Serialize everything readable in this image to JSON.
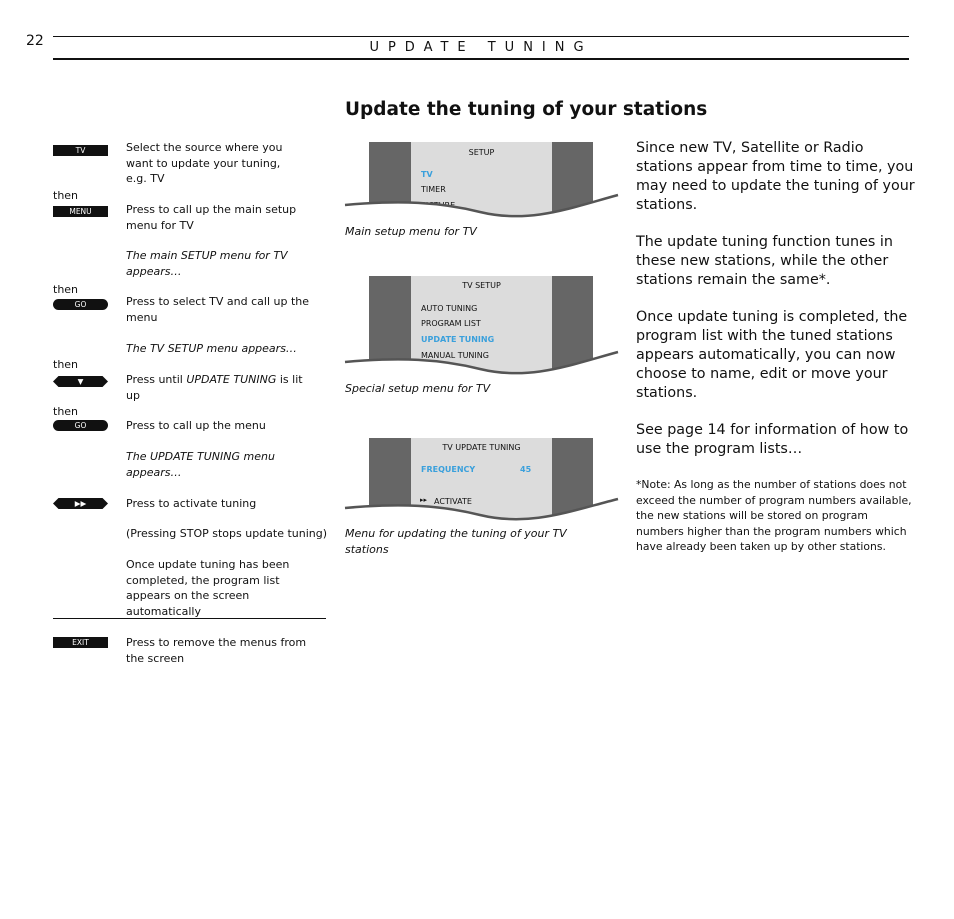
{
  "header": {
    "page_number": "22",
    "section_title": "UPDATE TUNING"
  },
  "heading": "Update the tuning of your stations",
  "steps": {
    "then": "then",
    "key_tv": "TV",
    "text_tv": "Select the source where you want to update your tuning, e.g. TV",
    "key_menu": "MENU",
    "text_menu": "Press to call up the main setup menu for TV",
    "note_setup": "The main SETUP menu for TV appears…",
    "key_go": "GO",
    "text_go1": "Press to select TV and call up the menu",
    "note_tvsetup": "The TV SETUP menu appears…",
    "key_down": "▼",
    "text_down_a": "Press until ",
    "text_down_b": "UPDATE TUNING",
    "text_down_c": " is lit up",
    "text_go2": "Press to call up the menu",
    "note_update": "The UPDATE TUNING menu appears…",
    "key_ff": "▶▶",
    "text_ff": "Press to activate tuning",
    "text_stop": "(Pressing STOP stops update tuning)",
    "text_done": "Once update tuning has been completed, the program list appears on the screen automatically",
    "key_exit": "EXIT",
    "text_exit": "Press to remove the menus from the screen"
  },
  "menus": [
    {
      "title": "SETUP",
      "items": [
        "TV",
        "TIMER",
        "PICTURE"
      ],
      "highlight": 0,
      "caption": "Main setup menu for TV"
    },
    {
      "title": "TV SETUP",
      "items": [
        "AUTO TUNING",
        "PROGRAM LIST",
        "UPDATE TUNING",
        "MANUAL TUNING"
      ],
      "highlight": 2,
      "caption": "Special setup menu for TV"
    },
    {
      "title": "TV UPDATE TUNING",
      "frequency_label": "FREQUENCY",
      "frequency_value": "45",
      "activate_label": "ACTIVATE",
      "caption": "Menu for updating the tuning of your TV stations"
    }
  ],
  "colors": {
    "highlight": "#3aa0dc",
    "frame": "#666666",
    "panel": "#dcdcdc"
  },
  "right": {
    "p1": "Since new TV, Satellite or Radio stations appear from time to time, you may need to update the tuning of your stations.",
    "p2": "The update tuning function tunes in these new stations, while the other stations remain the same*.",
    "p3": "Once update tuning is completed, the program list with the tuned stations appears automatically, you can now choose to name, edit or move your stations.",
    "p4": "See page 14 for information of how to use the program lists…",
    "note": "*Note: As long as the number of stations does not exceed the number of program numbers available, the new stations will be stored on program numbers higher than the program numbers which have already been taken up by other stations."
  }
}
